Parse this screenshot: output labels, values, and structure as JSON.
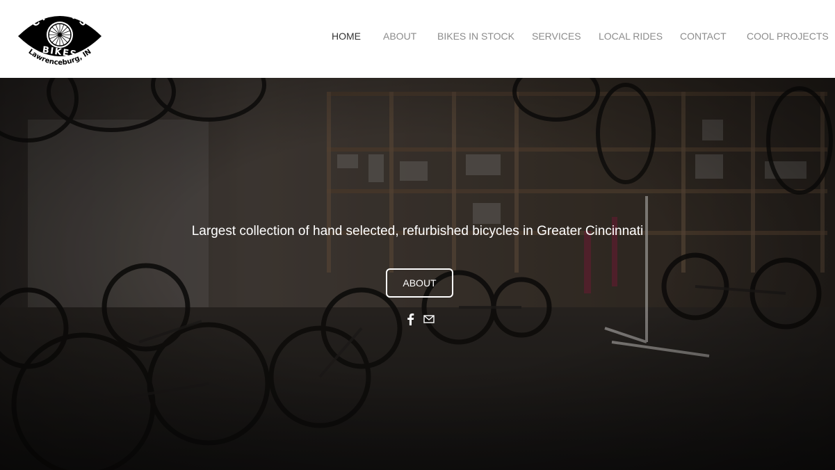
{
  "brand": {
    "logo_line1": "CYCLOPS",
    "logo_line2": "BIKES",
    "logo_line3": "Lawrenceburg, IN"
  },
  "nav": {
    "items": [
      {
        "label": "HOME",
        "active": true
      },
      {
        "label": "ABOUT"
      },
      {
        "label": "BIKES IN STOCK"
      },
      {
        "label": "SERVICES"
      },
      {
        "label": "LOCAL RIDES"
      },
      {
        "label": "CONTACT"
      },
      {
        "label": "COOL PROJECTS"
      }
    ]
  },
  "hero": {
    "tagline": "Largest collection of hand selected, refurbished bicycles in Greater Cincinnati",
    "button_label": "ABOUT"
  },
  "social": [
    {
      "icon": "facebook-icon"
    },
    {
      "icon": "mail-icon"
    }
  ],
  "colors": {
    "nav_active": "#333333",
    "nav_inactive": "#8c8c8c",
    "hero_text": "#ffffff"
  }
}
